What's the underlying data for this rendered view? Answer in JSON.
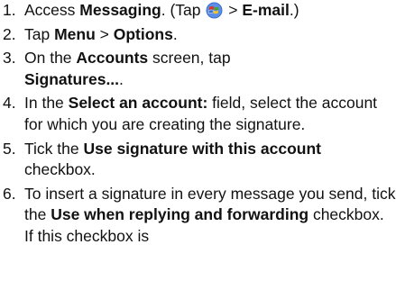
{
  "steps": [
    {
      "num": "1.",
      "parts": [
        "Access ",
        "Messaging",
        ". (Tap ",
        " > ",
        "E-mail",
        ".)"
      ],
      "icon": "windows-start-icon"
    },
    {
      "num": "2.",
      "parts": [
        "Tap ",
        "Menu",
        " > ",
        "Options",
        "."
      ]
    },
    {
      "num": "3.",
      "parts": [
        "On the ",
        "Accounts",
        " screen, tap",
        "Signatures...",
        "."
      ]
    },
    {
      "num": "4.",
      "parts": [
        "In the ",
        "Select an account:",
        " field, select the account for which you are creating the signature."
      ]
    },
    {
      "num": "5.",
      "parts": [
        "Tick the ",
        "Use signature with this account",
        " checkbox."
      ]
    },
    {
      "num": "6.",
      "parts": [
        "To insert a signature in every message you send, tick the ",
        "Use when replying and forwarding",
        " checkbox. If this checkbox is"
      ]
    }
  ],
  "colors": {
    "text": "#111111",
    "background": "#ffffff",
    "icon_blue": "#3b6fd0",
    "icon_red": "#d9372a",
    "icon_green": "#4aa33a",
    "icon_yellow": "#f2c12e"
  }
}
